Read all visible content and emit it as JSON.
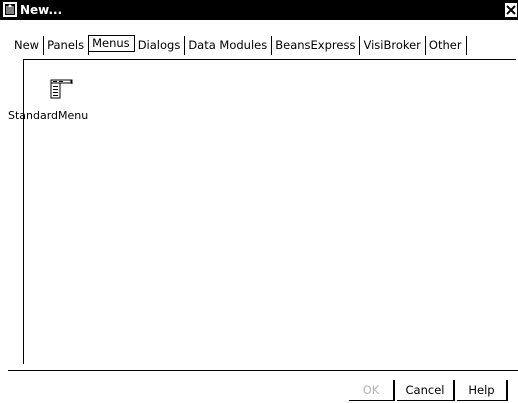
{
  "window": {
    "title": "New..."
  },
  "tabs": [
    {
      "label": "New",
      "selected": false
    },
    {
      "label": "Panels",
      "selected": false
    },
    {
      "label": "Menus",
      "selected": true
    },
    {
      "label": "Dialogs",
      "selected": false
    },
    {
      "label": "Data Modules",
      "selected": false
    },
    {
      "label": "BeansExpress",
      "selected": false
    },
    {
      "label": "VisiBroker",
      "selected": false
    },
    {
      "label": "Other",
      "selected": false
    }
  ],
  "items": [
    {
      "label": "StandardMenu",
      "icon": "menu-icon"
    }
  ],
  "buttons": {
    "ok": "OK",
    "cancel": "Cancel",
    "help": "Help"
  },
  "colors": {
    "titlebar": "#000000",
    "disabled_text": "#b4b4b4"
  }
}
